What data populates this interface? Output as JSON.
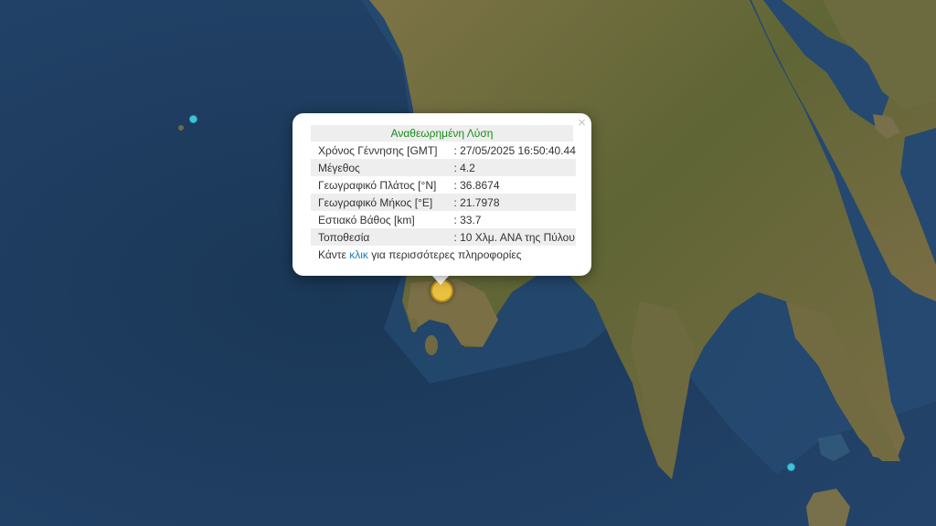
{
  "popup": {
    "title": "Αναθεωρημένη Λύση",
    "rows": [
      {
        "label": "Χρόνος Γέννησης [GMT]",
        "value": ": 27/05/2025 16:50:40.44"
      },
      {
        "label": "Μέγεθος",
        "value": ": 4.2"
      },
      {
        "label": "Γεωγραφικό Πλάτος [°N]",
        "value": ": 36.8674"
      },
      {
        "label": "Γεωγραφικό Μήκος [°E]",
        "value": ": 21.7978"
      },
      {
        "label": "Εστιακό Βάθος [km]",
        "value": ": 33.7"
      },
      {
        "label": "Τοποθεσία",
        "value": ": 10 Χλμ. ΑΝΑ της Πύλου"
      }
    ],
    "more_prefix": "Κάντε ",
    "more_link": "κλικ",
    "more_suffix": " για περισσότερες πληροφορίες",
    "close_symbol": "×"
  },
  "colors": {
    "sea": "#1d3a5a",
    "land": "#6b6a3c",
    "recent_quake_marker": "#3fc3d8",
    "selected_quake_marker": "#e9c140",
    "title_text": "#1a8a1a",
    "link": "#1a7fc0"
  }
}
